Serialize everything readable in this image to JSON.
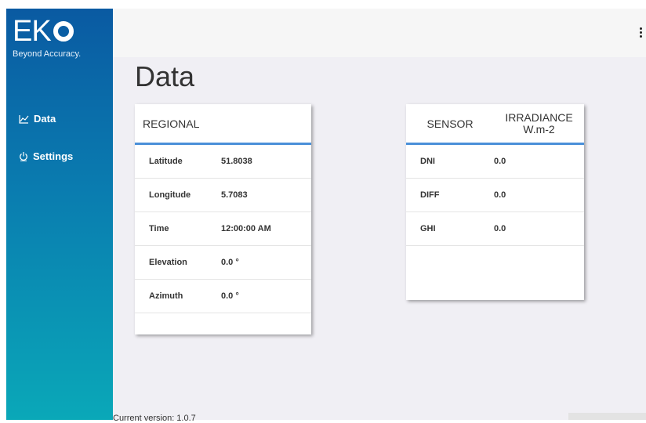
{
  "brand": {
    "logo_text": "EK",
    "tagline": "Beyond Accuracy."
  },
  "sidebar": {
    "items": [
      {
        "label": "Data",
        "icon": "chart-line-icon"
      },
      {
        "label": "Settings",
        "icon": "power-icon"
      }
    ]
  },
  "page": {
    "title": "Data"
  },
  "regional": {
    "header": "REGIONAL",
    "rows": [
      {
        "label": "Latitude",
        "value": "51.8038"
      },
      {
        "label": "Longitude",
        "value": "5.7083"
      },
      {
        "label": "Time",
        "value": "12:00:00 AM"
      },
      {
        "label": "Elevation",
        "value": "0.0 °"
      },
      {
        "label": "Azimuth",
        "value": "0.0 °"
      }
    ]
  },
  "sensor": {
    "header_sensor": "SENSOR",
    "header_irradiance": "IRRADIANCE",
    "header_unit": "W.m-2",
    "rows": [
      {
        "label": "DNI",
        "value": "0.0"
      },
      {
        "label": "DIFF",
        "value": "0.0"
      },
      {
        "label": "GHI",
        "value": "0.0"
      }
    ]
  },
  "footer": {
    "version_text": "Current version: 1.0.7"
  },
  "colors": {
    "accent": "#4a90d9",
    "sidebar_top": "#0a5aa2",
    "sidebar_bottom": "#0aa8b8"
  }
}
